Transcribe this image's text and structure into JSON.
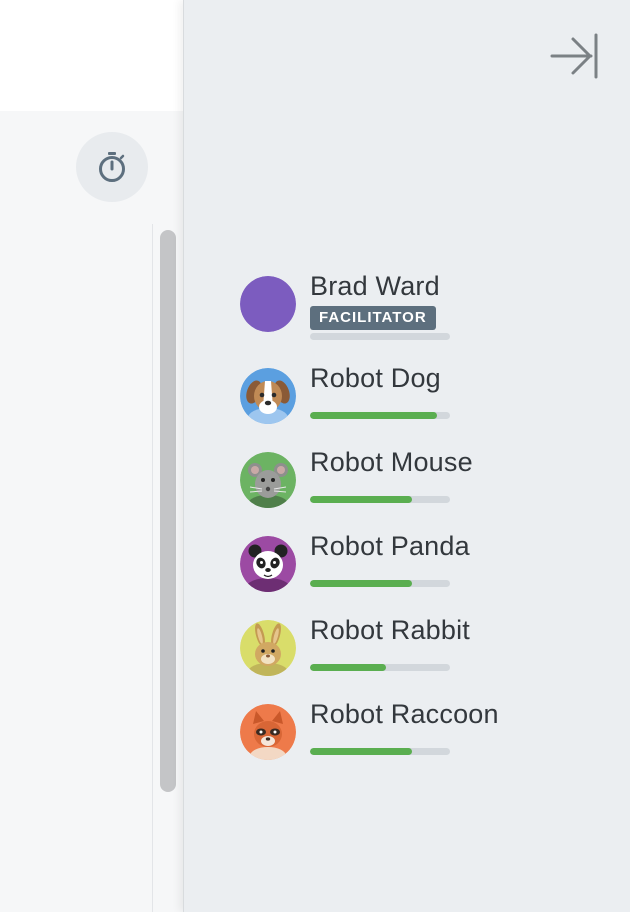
{
  "icons": {
    "timer": "stopwatch-icon",
    "collapse": "collapse-right-icon"
  },
  "colors": {
    "progress": "#5aae50",
    "facilitator_avatar": "#7c5cbf",
    "badge": "#5d6f7e"
  },
  "participants": [
    {
      "name": "Brad Ward",
      "role": "FACILITATOR",
      "progress": 0,
      "avatar": "purple-circle"
    },
    {
      "name": "Robot Dog",
      "progress": 0.91,
      "avatar": "dog-avatar"
    },
    {
      "name": "Robot Mouse",
      "progress": 0.73,
      "avatar": "mouse-avatar"
    },
    {
      "name": "Robot Panda",
      "progress": 0.73,
      "avatar": "panda-avatar"
    },
    {
      "name": "Robot Rabbit",
      "progress": 0.54,
      "avatar": "rabbit-avatar"
    },
    {
      "name": "Robot Raccoon",
      "progress": 0.73,
      "avatar": "raccoon-avatar"
    }
  ]
}
